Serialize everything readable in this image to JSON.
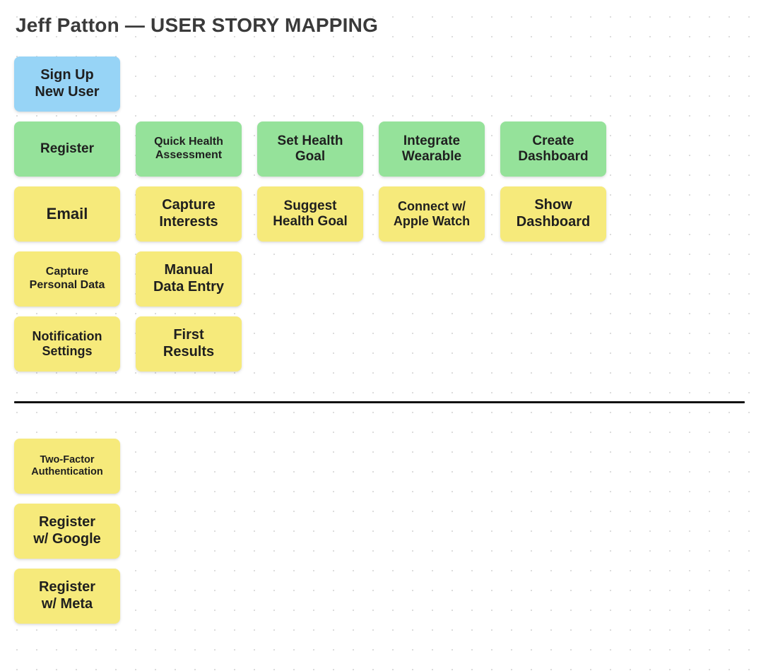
{
  "title": "Jeff Patton — USER STORY MAPPING",
  "colors": {
    "blue": "#97d4f6",
    "green": "#95e29a",
    "yellow": "#f6ea7b"
  },
  "activities": [
    {
      "label": "Sign Up\nNew User"
    }
  ],
  "steps": [
    {
      "label": "Register"
    },
    {
      "label": "Quick Health\nAssessment"
    },
    {
      "label": "Set Health\nGoal"
    },
    {
      "label": "Integrate\nWearable"
    },
    {
      "label": "Create\nDashboard"
    }
  ],
  "detailsRow1": [
    {
      "label": "Email"
    },
    {
      "label": "Capture\nInterests"
    },
    {
      "label": "Suggest\nHealth Goal"
    },
    {
      "label": "Connect w/\nApple Watch"
    },
    {
      "label": "Show\nDashboard"
    }
  ],
  "detailsRow2": [
    {
      "label": "Capture\nPersonal Data"
    },
    {
      "label": "Manual\nData Entry"
    }
  ],
  "detailsRow3": [
    {
      "label": "Notification\nSettings"
    },
    {
      "label": "First\nResults"
    }
  ],
  "backlog": [
    {
      "label": "Two-Factor\nAuthentication"
    },
    {
      "label": "Register\nw/ Google"
    },
    {
      "label": "Register\nw/ Meta"
    }
  ]
}
